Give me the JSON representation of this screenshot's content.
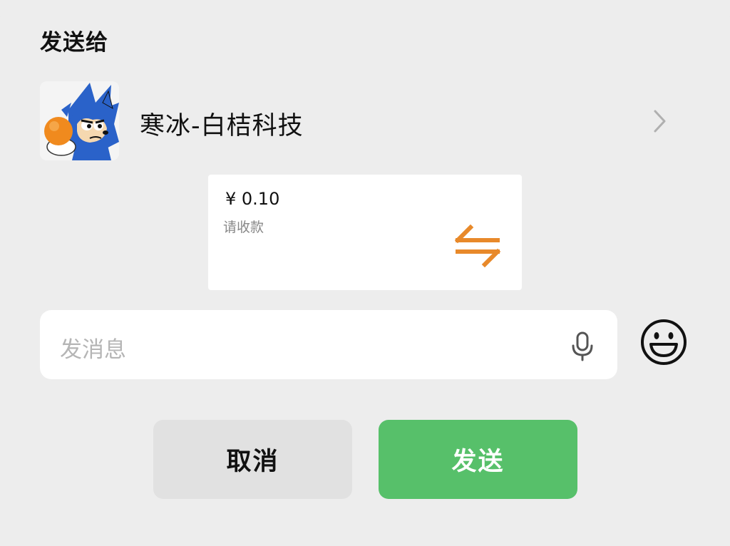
{
  "dialog": {
    "title": "发送给"
  },
  "contact": {
    "name": "寒冰-白桔科技",
    "avatar_icon": "cartoon-hedgehog-avatar"
  },
  "payment_card": {
    "amount": "¥ 0.10",
    "label": "请收款",
    "icon": "transfer-arrows-icon",
    "accent_color": "#e8892a"
  },
  "message": {
    "placeholder": "发消息",
    "value": ""
  },
  "buttons": {
    "cancel_label": "取消",
    "send_label": "发送",
    "send_color": "#57c06a"
  }
}
